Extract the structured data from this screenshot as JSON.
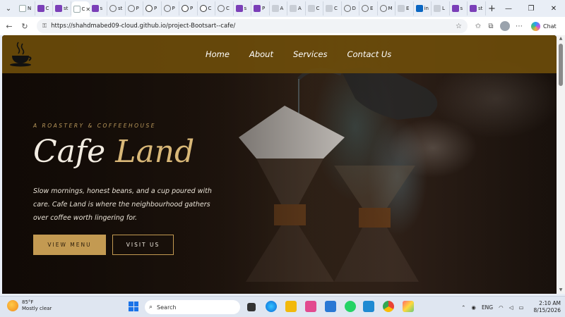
{
  "browser": {
    "tabs": [
      {
        "icon": "blank",
        "label": "N"
      },
      {
        "icon": "purple",
        "label": "C"
      },
      {
        "icon": "purple",
        "label": "st"
      },
      {
        "icon": "blank",
        "label": "C",
        "active": true
      },
      {
        "icon": "purple",
        "label": "s"
      },
      {
        "icon": "globe",
        "label": "st"
      },
      {
        "icon": "globe",
        "label": "P"
      },
      {
        "icon": "gh",
        "label": "P"
      },
      {
        "icon": "globe",
        "label": "P"
      },
      {
        "icon": "gh",
        "label": "P"
      },
      {
        "icon": "gh",
        "label": "C"
      },
      {
        "icon": "globe",
        "label": "C"
      },
      {
        "icon": "purple",
        "label": "s"
      },
      {
        "icon": "purple",
        "label": "P"
      },
      {
        "icon": "gray",
        "label": "A"
      },
      {
        "icon": "gray",
        "label": "A"
      },
      {
        "icon": "gray",
        "label": "C"
      },
      {
        "icon": "gray",
        "label": "C"
      },
      {
        "icon": "globe",
        "label": "D"
      },
      {
        "icon": "globe",
        "label": "E"
      },
      {
        "icon": "globe",
        "label": "M"
      },
      {
        "icon": "gray",
        "label": "E"
      },
      {
        "icon": "blue",
        "label": "in"
      },
      {
        "icon": "gray",
        "label": "L"
      },
      {
        "icon": "purple",
        "label": "s"
      },
      {
        "icon": "purple",
        "label": "st"
      }
    ],
    "url": "https://shahdmabed09-cloud.github.io/project-Bootsart--cafe/",
    "chat_label": "Chat"
  },
  "site": {
    "nav": {
      "home": "Home",
      "about": "About",
      "services": "Services",
      "contact": "Contact Us"
    },
    "hero": {
      "eyebrow": "A ROASTERY & COFFEEHOUSE",
      "title_white": "Cafe",
      "title_gold": "Land",
      "description": "Slow mornings, honest beans, and a cup poured with care. Cafe Land is where the neighbourhood gathers over coffee worth lingering for.",
      "btn_menu": "VIEW MENU",
      "btn_visit": "VISIT US"
    },
    "colors": {
      "navbar": "#704e0a",
      "gold": "#c39a52",
      "headline_gold": "#d9b878"
    }
  },
  "taskbar": {
    "weather_temp": "85°F",
    "weather_desc": "Mostly clear",
    "search_placeholder": "Search",
    "lang": "ENG",
    "time": "2:10 AM",
    "date": "8/15/2026"
  }
}
